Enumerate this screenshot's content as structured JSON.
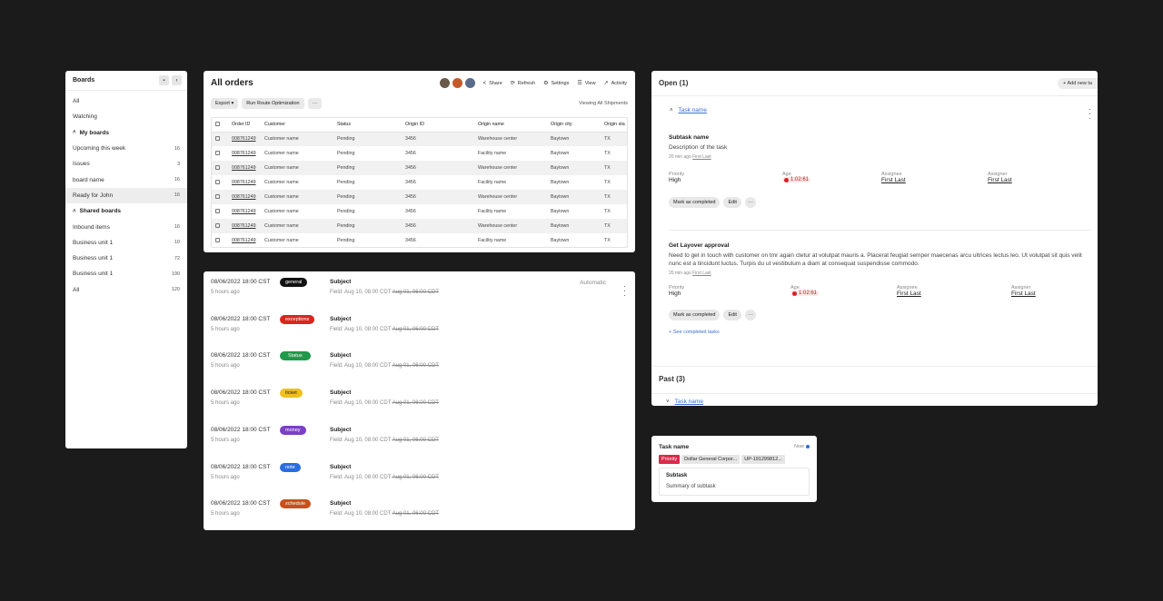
{
  "boards": {
    "title": "Boards",
    "items_top": [
      {
        "label": "All"
      },
      {
        "label": "Watching"
      }
    ],
    "my_boards_label": "My boards",
    "my_boards": [
      {
        "label": "Upcoming this week",
        "count": "16"
      },
      {
        "label": "Issues",
        "count": "3"
      },
      {
        "label": "board name",
        "count": "16"
      },
      {
        "label": "Ready for John",
        "count": "16"
      }
    ],
    "shared_boards_label": "Shared boards",
    "shared_boards": [
      {
        "label": "Inbound items",
        "count": "16"
      },
      {
        "label": "Business unit 1",
        "count": "10"
      },
      {
        "label": "Business unit 1",
        "count": "72"
      },
      {
        "label": "Business unit 1",
        "count": "190"
      },
      {
        "label": "All",
        "count": "120"
      }
    ]
  },
  "orders": {
    "title": "All orders",
    "avatar_colors": [
      "#6b5a4a",
      "#c45a2a",
      "#5a6b8a"
    ],
    "tools": {
      "share": "Share",
      "refresh": "Refresh",
      "settings": "Settings",
      "view": "View",
      "activity": "Activity"
    },
    "export_label": "Export",
    "route_label": "Run Route Optimization",
    "more_label": "···",
    "viewing": "Viewing All Shipments",
    "columns": [
      "Order ID",
      "Customer",
      "Status",
      "Origin ID",
      "Origin name",
      "Origin city",
      "Origin sta"
    ],
    "rows": [
      [
        "008761249",
        "Customer name",
        "Pending",
        "3456",
        "Warehouse center",
        "Baytown",
        "TX"
      ],
      [
        "008761249",
        "Customer name",
        "Pending",
        "3456",
        "Facility name",
        "Baytown",
        "TX"
      ],
      [
        "008761249",
        "Customer name",
        "Pending",
        "3456",
        "Warehouse center",
        "Baytown",
        "TX"
      ],
      [
        "008761249",
        "Customer name",
        "Pending",
        "3456",
        "Facility name",
        "Baytown",
        "TX"
      ],
      [
        "008761249",
        "Customer name",
        "Pending",
        "3456",
        "Warehouse center",
        "Baytown",
        "TX"
      ],
      [
        "008761249",
        "Customer name",
        "Pending",
        "3456",
        "Facility name",
        "Baytown",
        "TX"
      ],
      [
        "008761249",
        "Customer name",
        "Pending",
        "3456",
        "Warehouse center",
        "Baytown",
        "TX"
      ],
      [
        "008761249",
        "Customer name",
        "Pending",
        "3456",
        "Facility name",
        "Baytown",
        "TX"
      ]
    ]
  },
  "activity": {
    "automatic_label": "Automatic",
    "entries": [
      {
        "date": "08/06/2022 18:00 CST",
        "ago": "5 hours ago",
        "tag": "general",
        "tag_color": "#111111",
        "subject": "Subject",
        "field_new": "Field: Aug 10, 08:00 CDT",
        "field_old": "Aug 01, 06:00 CDT"
      },
      {
        "date": "08/06/2022 18:00 CST",
        "ago": "5 hours ago",
        "tag": "exceptions",
        "tag_color": "#d8261b",
        "subject": "Subject",
        "field_new": "Field: Aug 10, 08:00 CDT",
        "field_old": "Aug 01, 06:00 CDT"
      },
      {
        "date": "08/06/2022 18:00 CST",
        "ago": "5 hours ago",
        "tag": "Status",
        "tag_color": "#1f9a4a",
        "subject": "Subject",
        "field_new": "Field: Aug 10, 08:00 CDT",
        "field_old": "Aug 01, 06:00 CDT"
      },
      {
        "date": "08/06/2022 18:00 CST",
        "ago": "5 hours ago",
        "tag": "ticket",
        "tag_color": "#f0c020",
        "subject": "Subject",
        "field_new": "Field: Aug 10, 08:00 CDT",
        "field_old": "Aug 01, 06:00 CDT"
      },
      {
        "date": "08/06/2022 18:00 CST",
        "ago": "5 hours ago",
        "tag": "money",
        "tag_color": "#7b3fc4",
        "subject": "Subject",
        "field_new": "Field: Aug 10, 08:00 CDT",
        "field_old": "Aug 01, 06:00 CDT"
      },
      {
        "date": "08/06/2022 18:00 CST",
        "ago": "5 hours ago",
        "tag": "note",
        "tag_color": "#2a6de0",
        "subject": "Subject",
        "field_new": "Field: Aug 10, 08:00 CDT",
        "field_old": "Aug 01, 06:00 CDT"
      },
      {
        "date": "08/06/2022 18:00 CST",
        "ago": "5 hours ago",
        "tag": "schedule",
        "tag_color": "#c8501a",
        "subject": "Subject",
        "field_new": "Field: Aug 10, 08:00 CDT",
        "field_old": "Aug 01, 06:00 CDT"
      }
    ]
  },
  "open_tasks": {
    "title": "Open (1)",
    "add_label": "Add new ta",
    "task_link": "Task name",
    "subtask1": {
      "title": "Subtask name",
      "desc": "Description of the task",
      "meta_time": "20 min ago",
      "meta_user": "First Last",
      "priority_label": "Priority",
      "priority": "High",
      "age_label": "Age",
      "age": "1:02:61",
      "assignee_label": "Assignee",
      "assignee": "First Last",
      "assigner_label": "Assigner",
      "assigner": "First Last",
      "complete_label": "Mark as completed",
      "edit_label": "Edit"
    },
    "subtask2": {
      "title": "Get Layover approval",
      "desc": "Need to get in touch with customer on tmr again ctetur at volutpat mauris a. Placerat feugiat semper maecenas arcu ultrices lectus leo. Ut volutpat sit quis velit nunc est a tincidunt luctus. Turpis du ut vestibulum a diam at consequat suspendisse commodo.",
      "meta_time": "20 min ago",
      "meta_user": "First Last",
      "priority_label": "Priority",
      "priority": "High",
      "age_label": "Age",
      "age": "1:02:61",
      "assignee_label": "Assignee",
      "assignee": "First Last",
      "assigner_label": "Assigner",
      "assigner": "First Last",
      "complete_label": "Mark as completed",
      "edit_label": "Edit"
    },
    "see_completed": "See completed tasks",
    "past_title": "Past (3)",
    "past_link": "Task name"
  },
  "task_card": {
    "name": "Task name",
    "now": "Now",
    "tags": [
      "Priority",
      "Dollar General Corpor...",
      "UP-191299812..."
    ],
    "subtask_title": "Subtask",
    "subtask_summary": "Summary of subtask"
  }
}
